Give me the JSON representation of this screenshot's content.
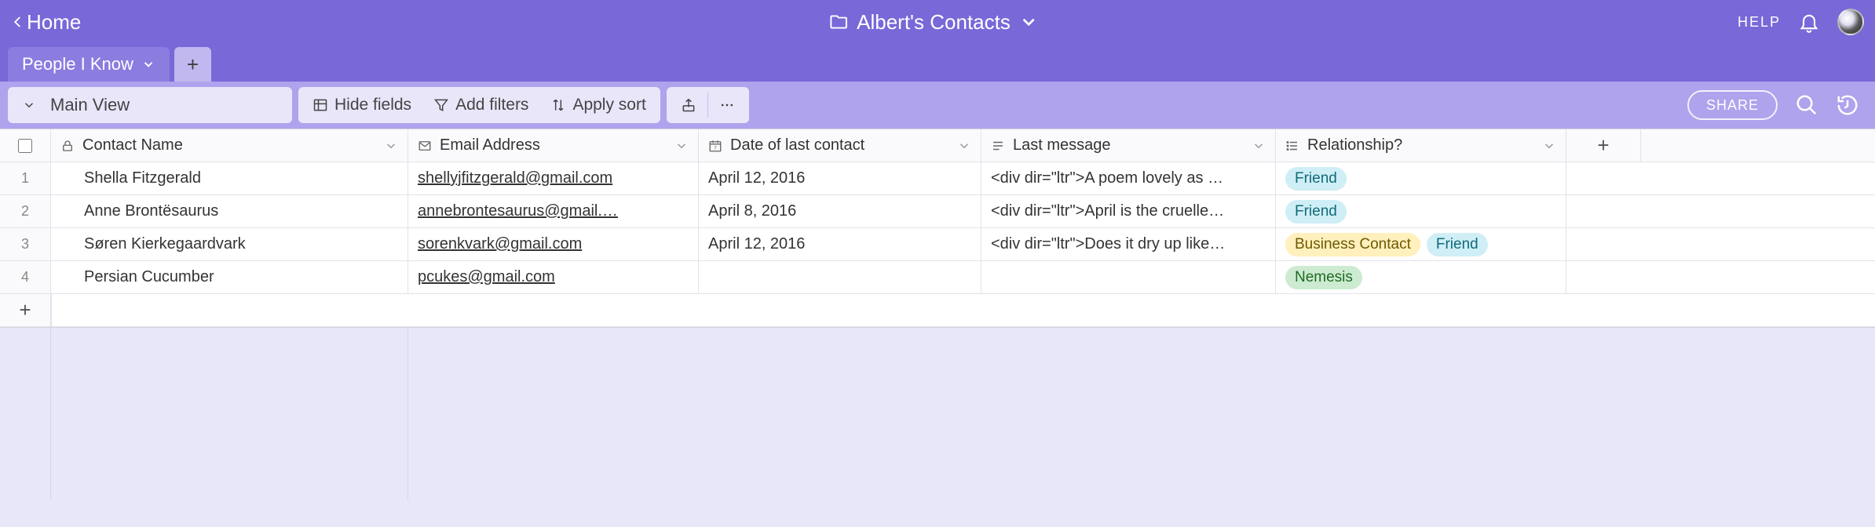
{
  "header": {
    "home_label": "Home",
    "base_name": "Albert's Contacts",
    "help_label": "HELP"
  },
  "tabs": {
    "active_tab": "People I Know"
  },
  "toolbar": {
    "view_name": "Main View",
    "hide_fields": "Hide fields",
    "add_filters": "Add filters",
    "apply_sort": "Apply sort",
    "share_label": "SHARE"
  },
  "columns": {
    "name": "Contact Name",
    "email": "Email Address",
    "date": "Date of last contact",
    "msg": "Last message",
    "rel": "Relationship?"
  },
  "rows": [
    {
      "num": "1",
      "name": "Shella Fitzgerald",
      "email": "shellyjfitzgerald@gmail.com",
      "date": "April 12, 2016",
      "msg": "<div dir=\"ltr\">A poem lovely as …",
      "rel": [
        {
          "label": "Friend",
          "cls": "friend"
        }
      ]
    },
    {
      "num": "2",
      "name": "Anne Brontësaurus",
      "email": "annebrontesaurus@gmail.…",
      "date": "April 8, 2016",
      "msg": "<div dir=\"ltr\">April is the cruelle…",
      "rel": [
        {
          "label": "Friend",
          "cls": "friend"
        }
      ]
    },
    {
      "num": "3",
      "name": "Søren Kierkegaardvark",
      "email": "sorenkvark@gmail.com",
      "date": "April 12, 2016",
      "msg": "<div dir=\"ltr\">Does it dry up like…",
      "rel": [
        {
          "label": "Business Contact",
          "cls": "business"
        },
        {
          "label": "Friend",
          "cls": "friend"
        }
      ]
    },
    {
      "num": "4",
      "name": "Persian Cucumber",
      "email": "pcukes@gmail.com",
      "date": "",
      "msg": "",
      "rel": [
        {
          "label": "Nemesis",
          "cls": "nemesis"
        }
      ]
    }
  ]
}
